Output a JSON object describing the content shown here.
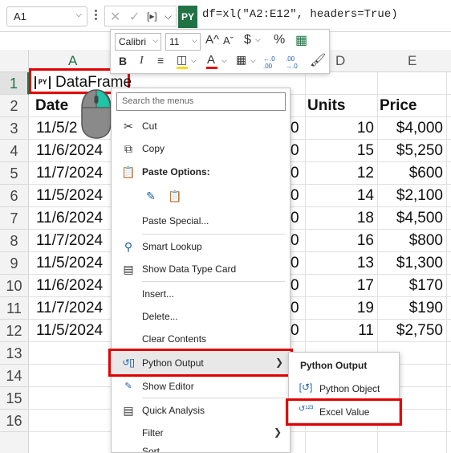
{
  "formula_bar": {
    "name_box": "A1",
    "py_badge": "PY",
    "formula": "df=xl(\"A2:E12\", headers=True)"
  },
  "mini_toolbar": {
    "font": "Calibri",
    "size": "11",
    "grow_font": "A^",
    "shrink_font": "Aˇ",
    "currency": "$",
    "percent": "%",
    "bold": "B",
    "italic": "I",
    "font_color_letter": "A",
    "font_color": "#e30000",
    "fill_color": "#ffd800",
    "dec_increase": "←.0 .00",
    "dec_decrease": ".00 →.0"
  },
  "columns": [
    "A",
    "D",
    "E"
  ],
  "rows": [
    "1",
    "2",
    "3",
    "4",
    "5",
    "6",
    "7",
    "8",
    "9",
    "10",
    "11",
    "12",
    "13",
    "14",
    "15",
    "16"
  ],
  "a1": {
    "tag": "PY",
    "text": "DataFrame"
  },
  "headers": {
    "a": "Date",
    "d": "Units",
    "e": "Price"
  },
  "col_a": [
    "11/5/2",
    "11/6/2024",
    "11/7/2024",
    "11/5/2024",
    "11/6/2024",
    "11/7/2024",
    "11/5/2024",
    "11/6/2024",
    "11/7/2024",
    "11/5/2024"
  ],
  "col_c_tail": [
    "0",
    "0",
    "0",
    "0",
    "0",
    "0",
    "0",
    "0",
    "0",
    "0"
  ],
  "units": [
    "10",
    "15",
    "12",
    "14",
    "18",
    "16",
    "13",
    "17",
    "19",
    "11"
  ],
  "price": [
    "$4,000",
    "$5,250",
    "$600",
    "$2,100",
    "$4,500",
    "$800",
    "$1,300",
    "$170",
    "$190",
    "$2,750"
  ],
  "context_menu": {
    "search_placeholder": "Search the menus",
    "cut": "Cut",
    "copy": "Copy",
    "paste_options": "Paste Options:",
    "paste_special": "Paste Special...",
    "smart_lookup": "Smart Lookup",
    "show_data_type_card": "Show Data Type Card",
    "insert": "Insert...",
    "delete": "Delete...",
    "clear_contents": "Clear Contents",
    "python_output": "Python Output",
    "show_editor": "Show Editor",
    "quick_analysis": "Quick Analysis",
    "filter": "Filter",
    "sort": "Sort"
  },
  "submenu": {
    "title": "Python Output",
    "python_object": "Python Object",
    "excel_value": "Excel Value"
  },
  "colors": {
    "accent_green": "#1e7145",
    "excel_green": "#217346",
    "highlight_red": "#e30000"
  }
}
